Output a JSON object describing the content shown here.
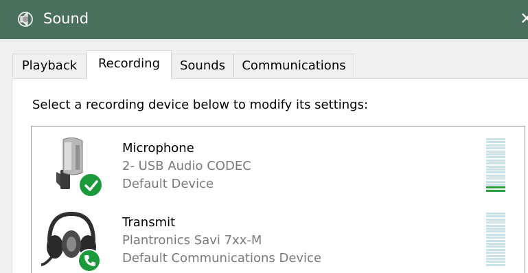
{
  "window": {
    "title": "Sound",
    "close_glyph": "✕",
    "icon": "speaker-icon",
    "colors": {
      "titlebar": "#4b6f5d",
      "panel": "#ffffff",
      "meter_off": "#c9e2e8",
      "meter_on": "#2c9c3c",
      "status_green": "#1a9a3a"
    }
  },
  "tabs": [
    {
      "label": "Playback",
      "selected": false
    },
    {
      "label": "Recording",
      "selected": true
    },
    {
      "label": "Sounds",
      "selected": false
    },
    {
      "label": "Communications",
      "selected": false
    }
  ],
  "instruction": "Select a recording device below to modify its settings:",
  "devices": [
    {
      "name": "Microphone",
      "driver": "2- USB Audio CODEC",
      "status": "Default Device",
      "icon": "microphone-icon",
      "badge_icon": "checkmark-icon",
      "level_segments_total": 18,
      "level_segments_on": 2
    },
    {
      "name": "Transmit",
      "driver": "Plantronics Savi 7xx-M",
      "status": "Default Communications Device",
      "icon": "headset-icon",
      "badge_icon": "phone-icon",
      "level_segments_total": 18,
      "level_segments_on": 0
    }
  ]
}
